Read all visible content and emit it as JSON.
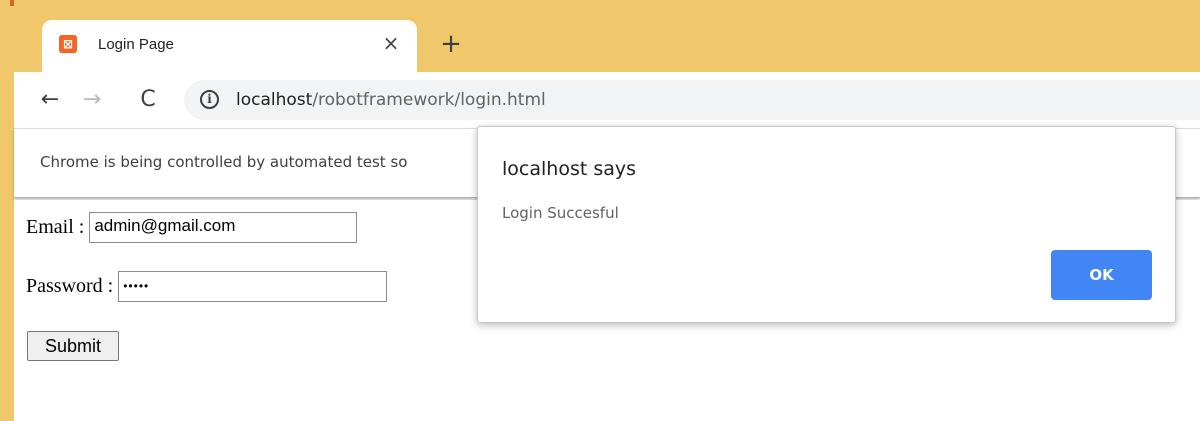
{
  "browser": {
    "tab": {
      "title": "Login Page",
      "favicon_name": "xampp-icon",
      "close_glyph": "×"
    },
    "new_tab_glyph": "+",
    "toolbar": {
      "back_glyph": "←",
      "forward_glyph": "→",
      "reload_glyph": "C",
      "info_glyph": "i",
      "url_host": "localhost",
      "url_path": "/robotframework/login.html"
    },
    "infobar": {
      "text": "Chrome is being controlled by automated test so"
    },
    "colors": {
      "frame": "#f0c76a",
      "accent": "#4285f4"
    }
  },
  "page": {
    "email_label": "Email :",
    "email_value": "admin@gmail.com",
    "password_label": "Password :",
    "password_value": "•••••",
    "submit_label": "Submit"
  },
  "dialog": {
    "title": "localhost says",
    "message": "Login Succesful",
    "ok_label": "OK"
  }
}
